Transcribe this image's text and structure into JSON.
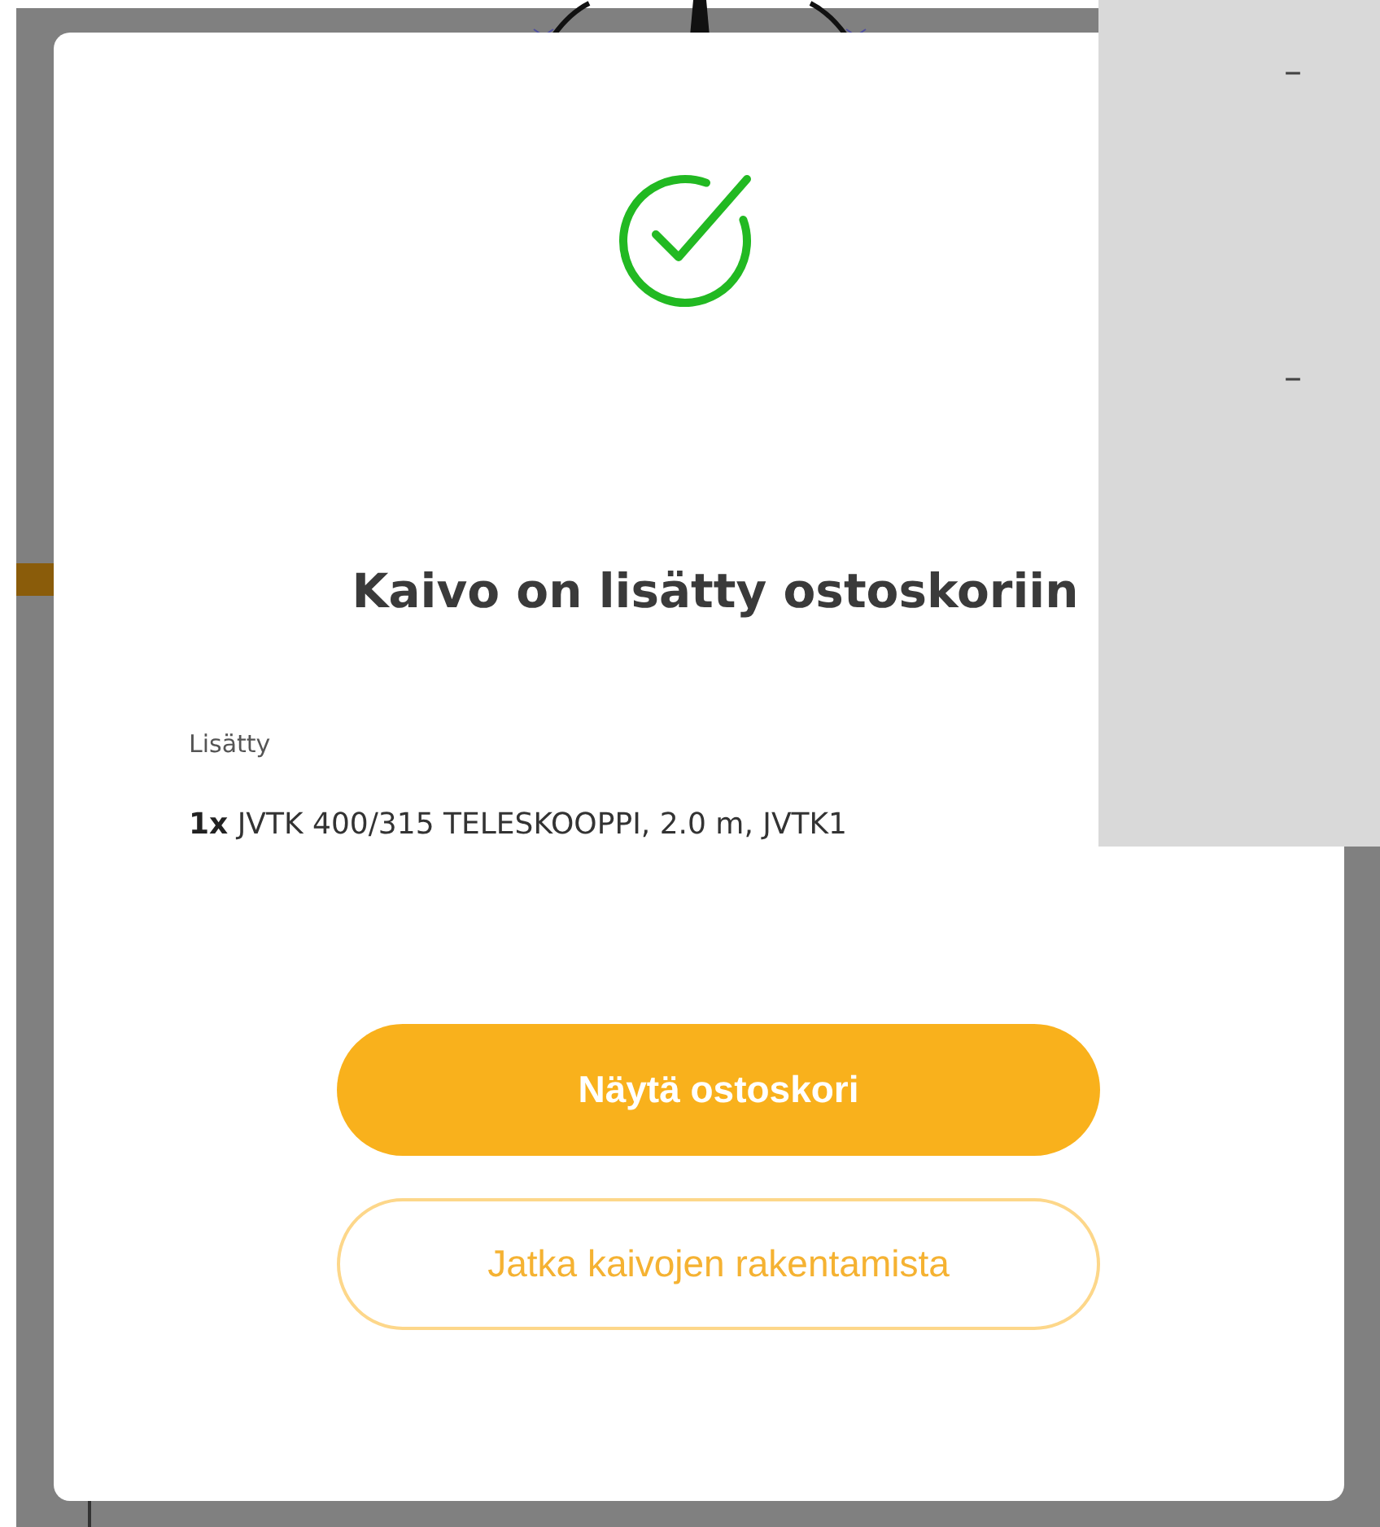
{
  "dialog": {
    "title": "Kaivo on lisätty ostoskoriin",
    "added_label": "Lisätty",
    "items": [
      {
        "quantity": "1x",
        "name": "JVTK 400/315 TELESKOOPPI, 2.0 m, JVTK1"
      }
    ],
    "buttons": [
      {
        "label": "Näytä ostoskori",
        "kind": "primary"
      },
      {
        "label": "Jatka kaivojen rakentamista",
        "kind": "secondary"
      }
    ]
  },
  "side_panel": {
    "markers": [
      "–",
      "–"
    ]
  }
}
